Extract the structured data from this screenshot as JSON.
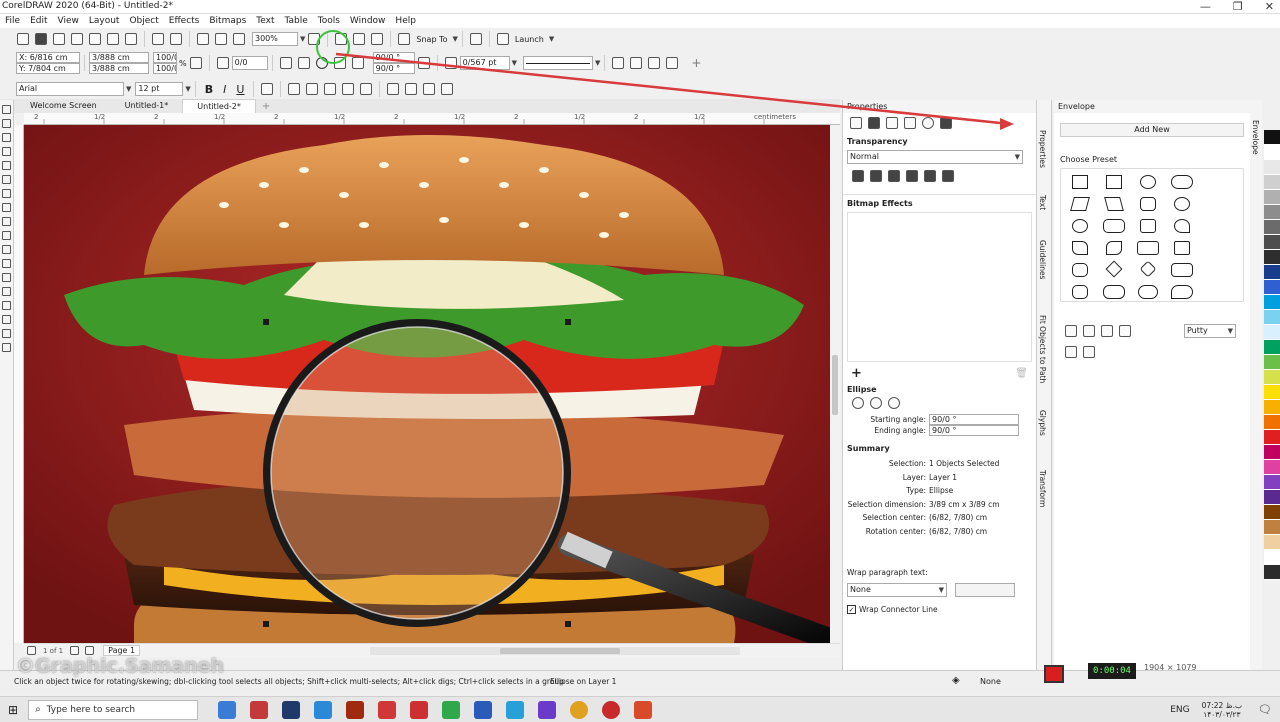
{
  "window": {
    "title": "CorelDRAW 2020 (64-Bit) - Untitled-2*",
    "controls": [
      "—",
      "❐",
      "✕"
    ]
  },
  "menu": [
    "File",
    "Edit",
    "View",
    "Layout",
    "Object",
    "Effects",
    "Bitmaps",
    "Text",
    "Table",
    "Tools",
    "Window",
    "Help"
  ],
  "standard_bar": {
    "zoom": "300%",
    "snap": "Snap To",
    "launch": "Launch"
  },
  "property_bar": {
    "x": "X: 6/816 cm",
    "y": "Y: 7/804 cm",
    "w": "3/888 cm",
    "h": "3/888 cm",
    "scale_w": "100/0",
    "scale_h": "100/0",
    "pct": "%",
    "rotation": "0/0",
    "angle_start": "90/0 °",
    "angle_end": "90/0 °",
    "outline": "0/567 pt"
  },
  "text_bar": {
    "font": "Arial",
    "size": "12 pt",
    "bold": "B",
    "italic": "I",
    "underline": "U"
  },
  "doc_tabs": [
    "Welcome Screen",
    "Untitled-1*",
    "Untitled-2*"
  ],
  "ruler": {
    "units": "centimeters",
    "ticks": [
      "2",
      "1/2",
      "2",
      "1/2",
      "2",
      "1/2",
      "2",
      "1/2",
      "2",
      "1/2",
      "2",
      "1/2",
      "2",
      "1/2"
    ]
  },
  "page_nav": {
    "counter": "1 of 1",
    "page": "Page 1"
  },
  "properties_panel": {
    "title": "Properties",
    "transparency": {
      "label": "Transparency",
      "mode": "Normal"
    },
    "bitmap_effects": "Bitmap Effects",
    "ellipse": {
      "label": "Ellipse",
      "start_label": "Starting angle:",
      "start": "90/0 °",
      "end_label": "Ending angle:",
      "end": "90/0 °"
    },
    "summary": {
      "label": "Summary",
      "rows": [
        {
          "k": "Selection:",
          "v": "1 Objects Selected"
        },
        {
          "k": "Layer:",
          "v": "Layer 1"
        },
        {
          "k": "Type:",
          "v": "Ellipse"
        },
        {
          "k": "Selection dimension:",
          "v": "3/89 cm x 3/89 cm"
        },
        {
          "k": "Selection center:",
          "v": "(6/82, 7/80) cm"
        },
        {
          "k": "Rotation center:",
          "v": "(6/82, 7/80) cm"
        }
      ]
    },
    "wrap": {
      "label": "Wrap paragraph text:",
      "value": "None",
      "connector": "Wrap Connector Line"
    }
  },
  "dock_tabs": [
    "Properties",
    "Text",
    "Guidelines",
    "Fit Objects to Path",
    "Glyphs",
    "Transform"
  ],
  "envelope_panel": {
    "title": "Envelope",
    "add_new": "Add New",
    "choose": "Choose Preset",
    "mode": "Putty",
    "tab": "Envelope"
  },
  "palette": [
    "#111111",
    "#ffffff",
    "#e8e8e8",
    "#cfcfcf",
    "#b0b0b0",
    "#8d8d8d",
    "#6b6b6b",
    "#4d4d4d",
    "#2e2e2e",
    "#1a3c8c",
    "#2f5fd0",
    "#00a0e0",
    "#7ad1f0",
    "#d8f0ff",
    "#00a060",
    "#6cc04a",
    "#d6e04a",
    "#ffe000",
    "#f8b000",
    "#f07000",
    "#e02020",
    "#c00060",
    "#e040a0",
    "#8040c0",
    "#5a2a90",
    "#804000",
    "#c08040",
    "#f0d0a0",
    "#ffffff",
    "#2c2c2c"
  ],
  "status": {
    "hint": "Click an object twice for rotating/skewing; dbl-clicking tool selects all objects; Shift+click multi-selects; Alt+click digs; Ctrl+click selects in a group",
    "object": "Ellipse on Layer 1",
    "fill": "None"
  },
  "taskbar": {
    "search": "Type here to search",
    "lang": "ENG",
    "time": "07:22 ب.ظ",
    "date": "۱۴۰۳/۰۳/۲۳"
  },
  "overlay": {
    "watermark": "©Graphic.Samaneh",
    "resolution": "1904 × 1079"
  },
  "colors": {
    "accent": "#d83b3b",
    "bg": "#8c1d1d"
  }
}
